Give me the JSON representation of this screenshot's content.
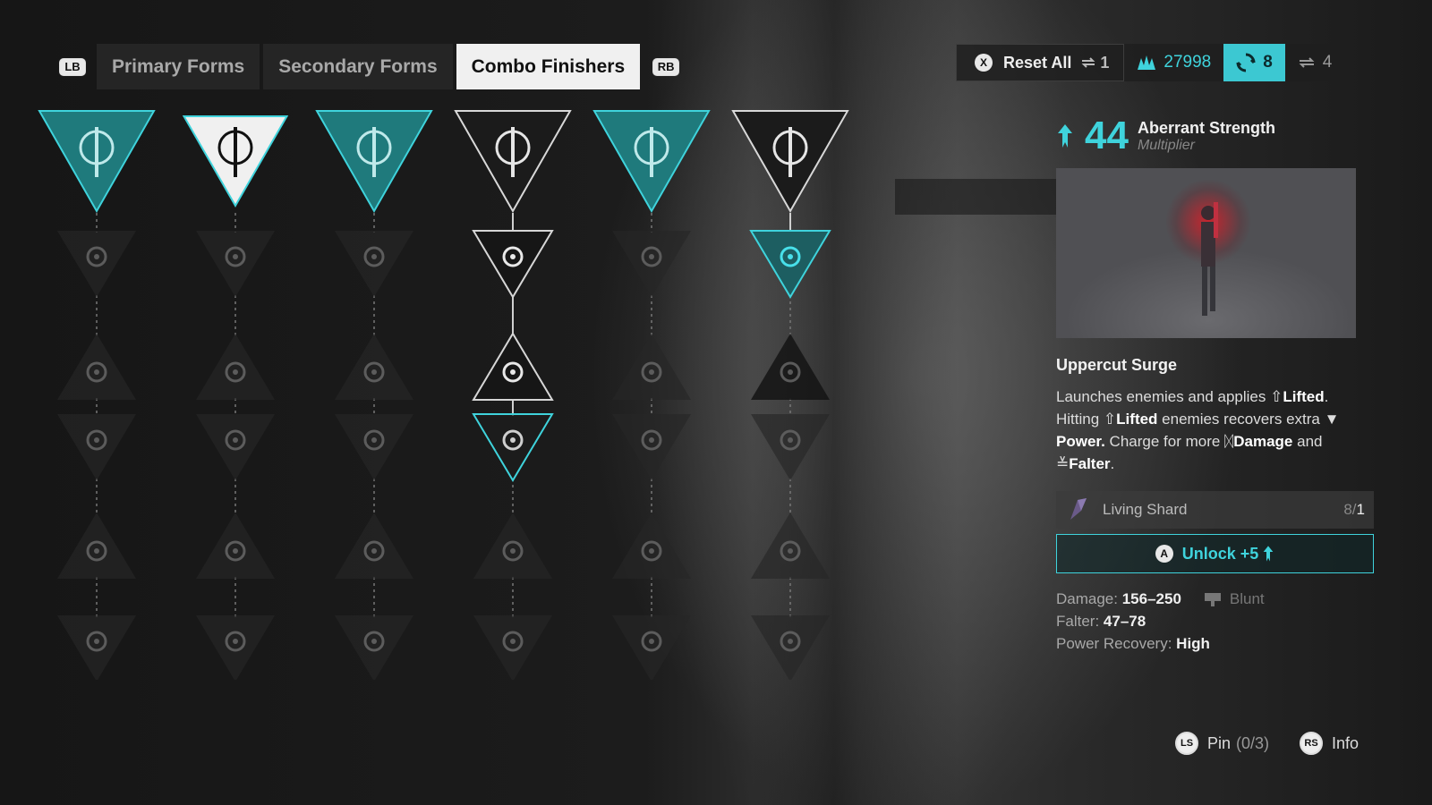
{
  "tabs": {
    "left_bumper": "LB",
    "right_bumper": "RB",
    "items": [
      {
        "label": "Primary Forms",
        "active": false
      },
      {
        "label": "Secondary Forms",
        "active": false
      },
      {
        "label": "Combo Finishers",
        "active": true
      }
    ]
  },
  "topbar": {
    "reset_button": "X",
    "reset_label": "Reset All",
    "reset_count": "1",
    "currency_1": "27998",
    "currency_2": "8",
    "currency_3": "4",
    "accent": "#3fd3dc"
  },
  "tree": {
    "columns": [
      {
        "top_icon": "claw-blades-icon",
        "top_state": "teal",
        "children": [
          "skull-flame-icon",
          "skull-down-icon",
          "chevrons-up-icon",
          "figure-icon",
          "clock-icon"
        ],
        "child_state": [
          "dim",
          "dim",
          "dim",
          "dim",
          "dim"
        ],
        "links": "dotted"
      },
      {
        "top_icon": "hanging-rune-icon",
        "top_state": "white",
        "children": [
          "flask-icon",
          "gear-face-icon",
          "skull-cross-icon",
          "arrow-up-face-icon",
          "fist-icon"
        ],
        "child_state": [
          "dim",
          "dim",
          "dim",
          "dim",
          "dim"
        ],
        "links": "dotted"
      },
      {
        "top_icon": "blade-icon",
        "top_state": "teal",
        "children": [
          "stack-down-icon",
          "skull-plus-icon",
          "spark-icon",
          "alert-icon",
          "figure-down-icon"
        ],
        "child_state": [
          "dim",
          "dim",
          "dim",
          "dim",
          "dim"
        ],
        "links": "dotted"
      },
      {
        "top_icon": "twin-blade-icon",
        "top_state": "dark-active",
        "children": [
          "power-down-icon",
          "impact-icon",
          "skull-down-icon",
          "flame-ring-icon",
          "infinity-icon"
        ],
        "child_state": [
          "active",
          "active",
          "teal-outline",
          "dim",
          "dim"
        ],
        "links": "solid3"
      },
      {
        "top_icon": "thorn-branch-icon",
        "top_state": "teal",
        "children": [
          "skull-cross-icon",
          "shield-icon",
          "burst-icon",
          "star-burst-icon",
          "face-ring-icon"
        ],
        "child_state": [
          "dim",
          "dim",
          "dim",
          "dim",
          "dim"
        ],
        "links": "dotted"
      },
      {
        "top_icon": "triskele-icon",
        "top_state": "dark-active",
        "children": [
          "skull-loop-icon",
          "cycle-icon",
          "flame-circle-icon",
          "ring-icon",
          "swirl-icon"
        ],
        "child_state": [
          "selected",
          "dim-dark",
          "dim",
          "dim",
          "dim"
        ],
        "links": "solid1"
      }
    ]
  },
  "panel": {
    "stat_value": "44",
    "stat_name": "Aberrant Strength",
    "stat_sub": "Multiplier",
    "skill_title": "Uppercut Surge",
    "desc": {
      "p1": "Launches enemies and applies ",
      "lifted": "Lifted",
      "p2": ". Hitting ",
      "lifted2": "Lifted",
      "p3": " enemies recovers extra ",
      "power": "Power.",
      "p4": " Charge for more ",
      "damage": "Damage",
      "p5": " and ",
      "falter": "Falter",
      "p6": "."
    },
    "req_name": "Living Shard",
    "req_have": "8",
    "req_sep": "/",
    "req_need": "1",
    "unlock_button": "A",
    "unlock_label": "Unlock +5",
    "damage_label": "Damage:",
    "damage_value": "156–250",
    "damage_type": "Blunt",
    "falter_label": "Falter:",
    "falter_value": "47–78",
    "power_label": "Power Recovery:",
    "power_value": "High"
  },
  "hints": {
    "pin_stick": "LS",
    "pin_label": "Pin",
    "pin_count": "(0/3)",
    "info_stick": "RS",
    "info_label": "Info"
  }
}
